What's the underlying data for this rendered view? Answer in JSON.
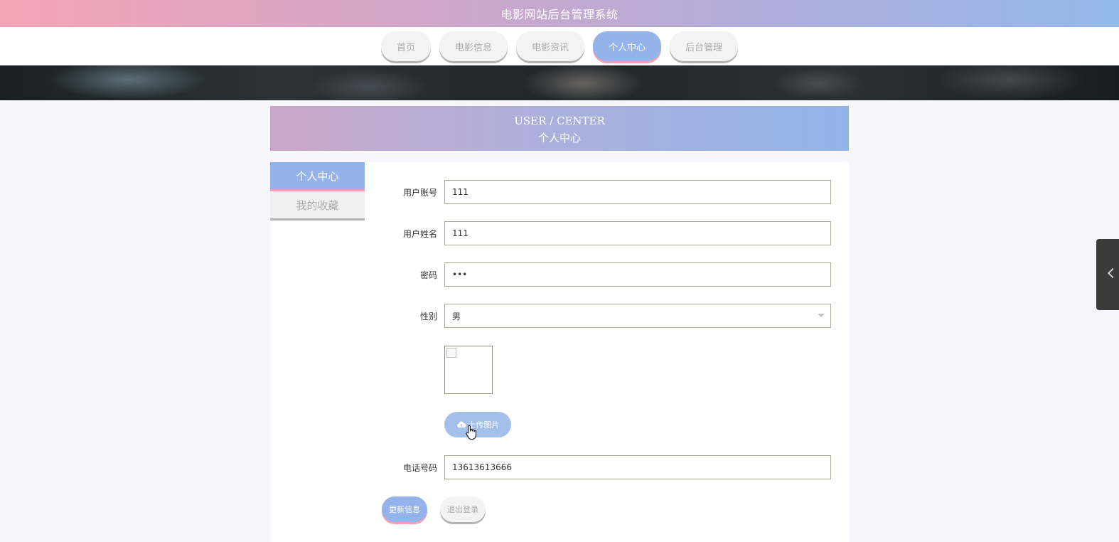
{
  "header": {
    "title": "电影网站后台管理系统"
  },
  "nav": {
    "items": [
      {
        "label": "首页",
        "active": false
      },
      {
        "label": "电影信息",
        "active": false
      },
      {
        "label": "电影资讯",
        "active": false
      },
      {
        "label": "个人中心",
        "active": true
      },
      {
        "label": "后台管理",
        "active": false
      }
    ]
  },
  "section": {
    "title_en": "USER / CENTER",
    "title_cn": "个人中心"
  },
  "sidebar": {
    "items": [
      {
        "label": "个人中心",
        "active": true
      },
      {
        "label": "我的收藏",
        "active": false
      }
    ]
  },
  "form": {
    "account": {
      "label": "用户账号",
      "value": "111"
    },
    "name": {
      "label": "用户姓名",
      "value": "111"
    },
    "password": {
      "label": "密码",
      "value": "•••"
    },
    "gender": {
      "label": "性别",
      "value": "男"
    },
    "upload_label": "上传图片",
    "phone": {
      "label": "电话号码",
      "value": "13613613666"
    }
  },
  "actions": {
    "update_label": "更新信息",
    "logout_label": "退出登录"
  },
  "colors": {
    "accent_blue": "#93b3ea",
    "accent_pink": "#f3a0b1",
    "header_gradient_start": "#f5a3b4",
    "header_gradient_end": "#93b8ea"
  },
  "icons": {
    "upload": "cloud-upload-icon",
    "cursor": "hand-pointer-icon",
    "side_handle": "chevron-left-icon"
  }
}
